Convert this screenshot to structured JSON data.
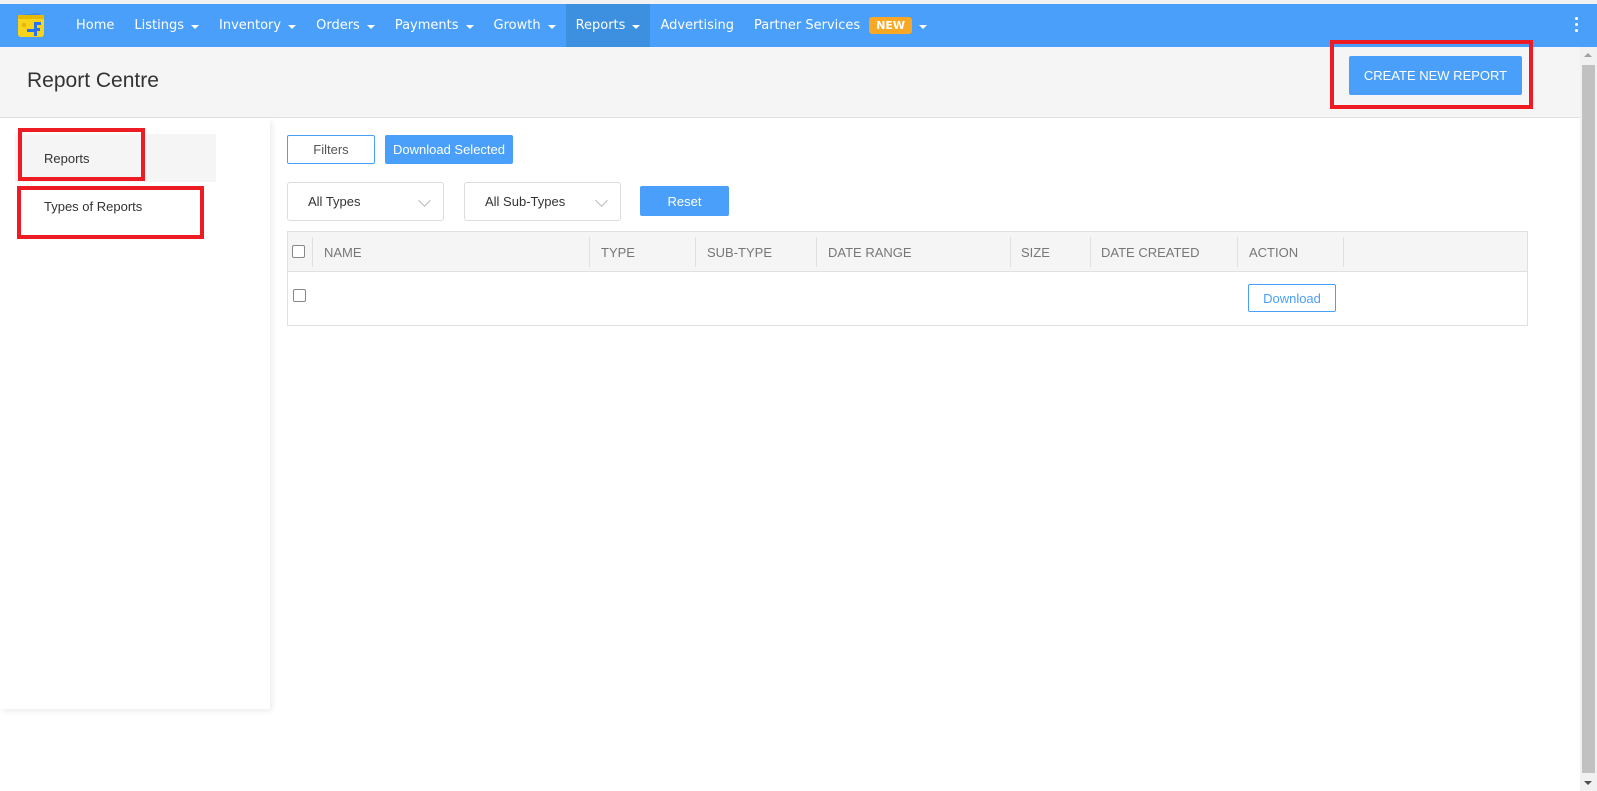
{
  "nav": {
    "logo": "flipkart-seller-logo",
    "items": [
      {
        "label": "Home",
        "dropdown": false
      },
      {
        "label": "Listings",
        "dropdown": true
      },
      {
        "label": "Inventory",
        "dropdown": true
      },
      {
        "label": "Orders",
        "dropdown": true
      },
      {
        "label": "Payments",
        "dropdown": true
      },
      {
        "label": "Growth",
        "dropdown": true
      },
      {
        "label": "Reports",
        "dropdown": true,
        "active": true
      },
      {
        "label": "Advertising",
        "dropdown": false
      },
      {
        "label": "Partner Services",
        "dropdown": true,
        "badge": "NEW"
      }
    ],
    "more_icon": "kebab-menu-icon",
    "colors": {
      "bar": "#499ffa",
      "active": "#3d8fe0",
      "badge": "#f9a825"
    }
  },
  "header": {
    "title": "Report Centre",
    "create_button": "CREATE NEW REPORT"
  },
  "sidebar": {
    "items": [
      {
        "label": "Reports",
        "active": true
      },
      {
        "label": "Types of Reports",
        "active": false
      }
    ]
  },
  "toolbar": {
    "filters_label": "Filters",
    "download_selected_label": "Download Selected",
    "type_select": "All Types",
    "subtype_select": "All Sub-Types",
    "reset_label": "Reset"
  },
  "table": {
    "columns": [
      "NAME",
      "TYPE",
      "SUB-TYPE",
      "DATE RANGE",
      "SIZE",
      "DATE CREATED",
      "ACTION"
    ],
    "rows": [
      {
        "name": "",
        "type": "",
        "sub_type": "",
        "date_range": "",
        "size": "",
        "date_created": "",
        "action": "Download"
      }
    ]
  },
  "highlights": [
    "create-new-report",
    "sidebar-reports",
    "sidebar-types-of-reports"
  ]
}
